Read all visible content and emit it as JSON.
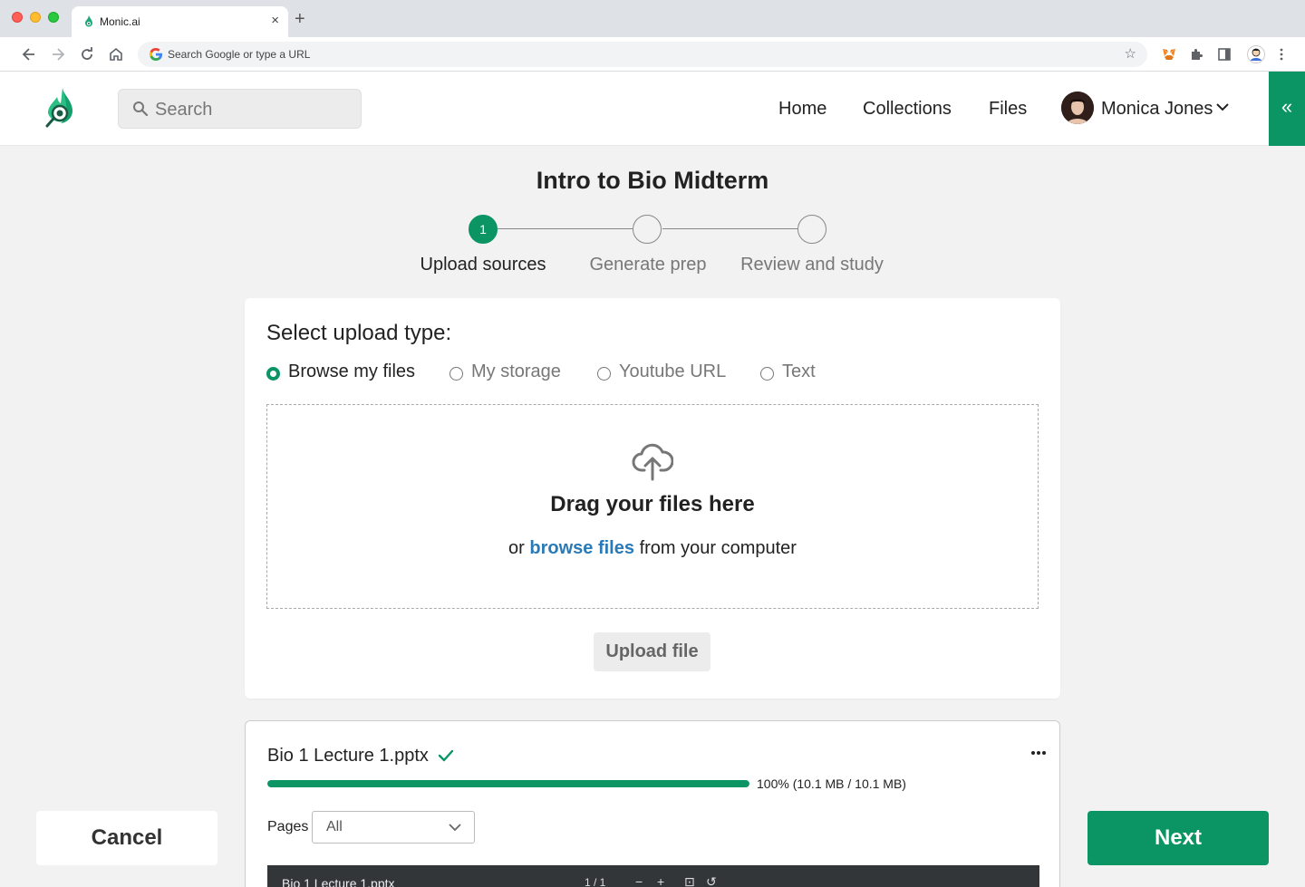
{
  "browser": {
    "tab_title": "Monic.ai",
    "tab_close": "×",
    "new_tab": "+",
    "omnibox_placeholder": "Search Google or type a URL"
  },
  "header": {
    "search_placeholder": "Search",
    "nav": [
      "Home",
      "Collections",
      "Files"
    ],
    "user_name": "Monica Jones",
    "collapse_icon": "«",
    "brand_color": "#0b9464"
  },
  "page": {
    "title": "Intro to Bio Midterm"
  },
  "stepper": {
    "steps": [
      {
        "number": "1",
        "label": "Upload sources",
        "active": true
      },
      {
        "number": "",
        "label": "Generate prep",
        "active": false
      },
      {
        "number": "",
        "label": "Review and study",
        "active": false
      }
    ]
  },
  "upload": {
    "heading": "Select upload type:",
    "options": [
      {
        "label": "Browse my files",
        "checked": true
      },
      {
        "label": "My storage",
        "checked": false
      },
      {
        "label": "Youtube URL",
        "checked": false
      },
      {
        "label": "Text",
        "checked": false
      }
    ],
    "drag_title": "Drag your files here",
    "drag_prefix": "or",
    "browse_link": "browse files",
    "drag_suffix": "from your computer",
    "upload_button": "Upload file"
  },
  "file": {
    "name": "Bio 1 Lecture 1.pptx",
    "progress_percent": 100,
    "progress_text": "100% (10.1 MB / 10.1 MB)",
    "pages_label": "Pages",
    "pages_value": "All",
    "preview_title": "Bio 1 Lecture 1.pptx",
    "preview_pages": "1 / 1",
    "preview_minus": "−",
    "preview_plus": "+"
  },
  "footer": {
    "cancel": "Cancel",
    "next": "Next"
  }
}
